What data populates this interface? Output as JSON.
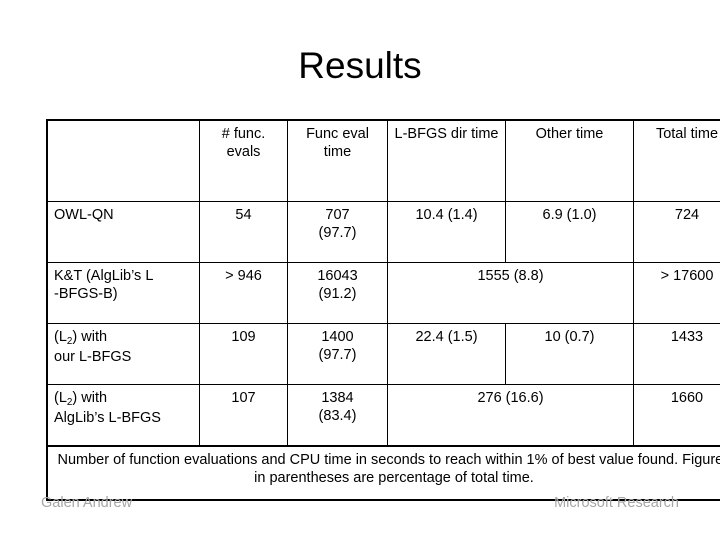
{
  "slide": {
    "title": "Results"
  },
  "table": {
    "columns": [
      {
        "key": "label",
        "header": ""
      },
      {
        "key": "funcev",
        "header": "# func. evals"
      },
      {
        "key": "functm",
        "header": "Func eval time"
      },
      {
        "key": "lbfgs",
        "header": "L-BFGS dir time"
      },
      {
        "key": "other",
        "header": "Other time"
      },
      {
        "key": "total",
        "header": "Total time"
      }
    ],
    "rows": [
      {
        "label": "OWL-QN",
        "funcev": "54",
        "functm_line1": "707",
        "functm_line2": "(97.7)",
        "lbfgs": "10.4 (1.4)",
        "other": "6.9 (1.0)",
        "total": "724",
        "merged": false
      },
      {
        "label_line1": "K&T (AlgLib’s L",
        "label_line2": "-BFGS-B)",
        "funcev": "> 946",
        "functm_line1": "16043",
        "functm_line2": "(91.2)",
        "merged_value": "1555 (8.8)",
        "total": "> 17600",
        "merged": true
      },
      {
        "label_prefix": "(L",
        "label_sub": "2",
        "label_suffix": ") with",
        "label_line2": "our L-BFGS",
        "funcev": "109",
        "functm_line1": "1400",
        "functm_line2": "(97.7)",
        "lbfgs": "22.4 (1.5)",
        "other": "10 (0.7)",
        "total": "1433",
        "merged": false
      },
      {
        "label_prefix": "(L",
        "label_sub": "2",
        "label_suffix": ") with",
        "label_line2": "AlgLib’s L-BFGS",
        "funcev": "107",
        "functm_line1": "1384",
        "functm_line2": "(83.4)",
        "merged_value": "276 (16.6)",
        "total": "1660",
        "merged": true
      }
    ],
    "caption": "Number of function evaluations and CPU time in seconds to reach within 1% of best value found. Figures in parentheses are percentage of total time."
  },
  "footer": {
    "left": "Galen Andrew",
    "right": "Microsoft Research"
  },
  "chart_data": {
    "type": "table",
    "title": "Results",
    "columns": [
      "",
      "# func. evals",
      "Func eval time",
      "L-BFGS dir time",
      "Other time",
      "Total time"
    ],
    "rows": [
      [
        "OWL-QN",
        "54",
        "707 (97.7)",
        "10.4 (1.4)",
        "6.9 (1.0)",
        "724"
      ],
      [
        "K&T (AlgLib’s L-BFGS-B)",
        "> 946",
        "16043 (91.2)",
        "1555 (8.8)",
        "1555 (8.8)",
        "> 17600"
      ],
      [
        "(L2) with our L-BFGS",
        "109",
        "1400 (97.7)",
        "22.4 (1.5)",
        "10 (0.7)",
        "1433"
      ],
      [
        "(L2) with AlgLib’s L-BFGS",
        "107",
        "1384 (83.4)",
        "276 (16.6)",
        "276 (16.6)",
        "1660"
      ]
    ],
    "caption": "Number of function evaluations and CPU time in seconds to reach within 1% of best value found. Figures in parentheses are percentage of total time."
  }
}
